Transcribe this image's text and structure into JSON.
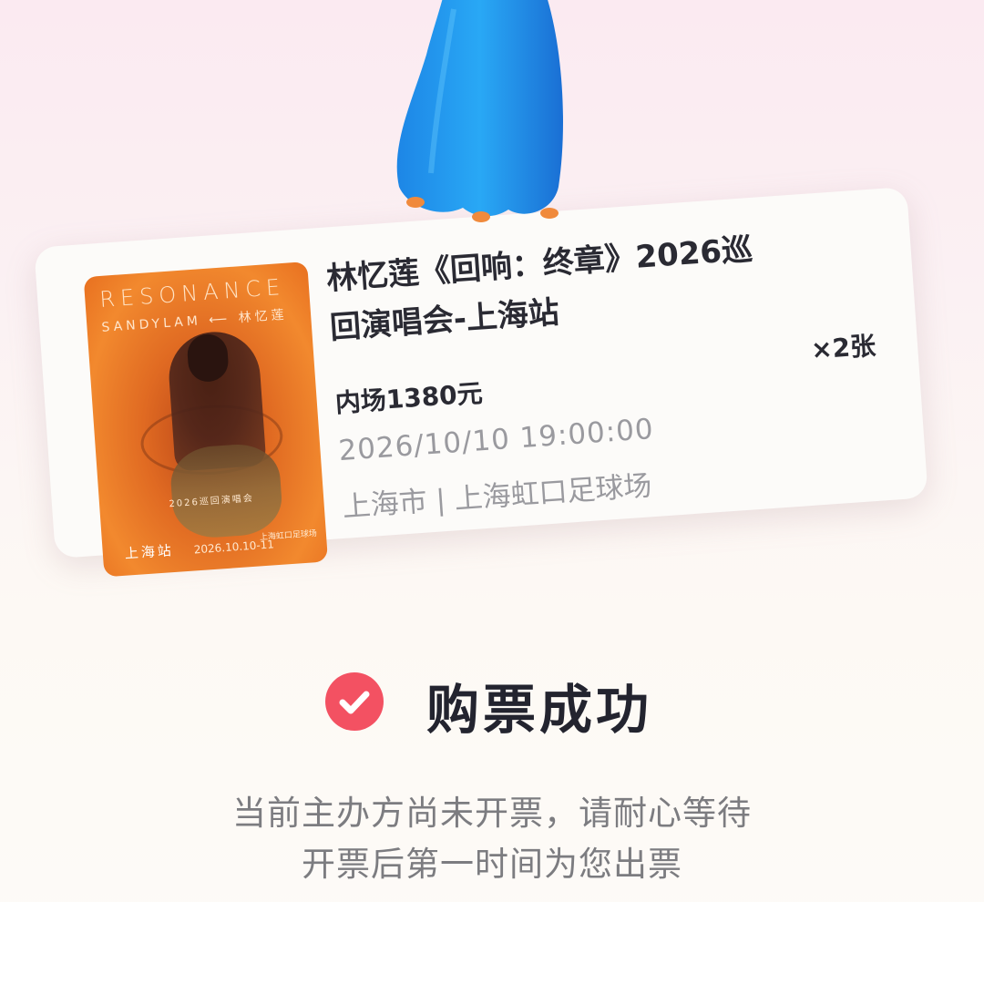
{
  "ticket": {
    "poster": {
      "title": "RESONANCE",
      "artist": "SANDYLAM ⟵ 林忆莲",
      "subtitle": "2026巡回演唱会",
      "city": "上海站",
      "date": "2026.10.10-11",
      "venue": "上海虹口足球场"
    },
    "title_line1": "林忆莲《回响：终章》2026巡",
    "title_line2": "回演唱会-上海站",
    "quantity": "×2张",
    "price": "内场1380元",
    "datetime": "2026/10/10 19:00:00",
    "location": "上海市 | 上海虹口足球场"
  },
  "status": {
    "title": "购票成功",
    "icon": "check-circle-icon",
    "color": "#f35162"
  },
  "message": {
    "line1": "当前主办方尚未开票，请耐心等待",
    "line2": "开票后第一时间为您出票"
  }
}
